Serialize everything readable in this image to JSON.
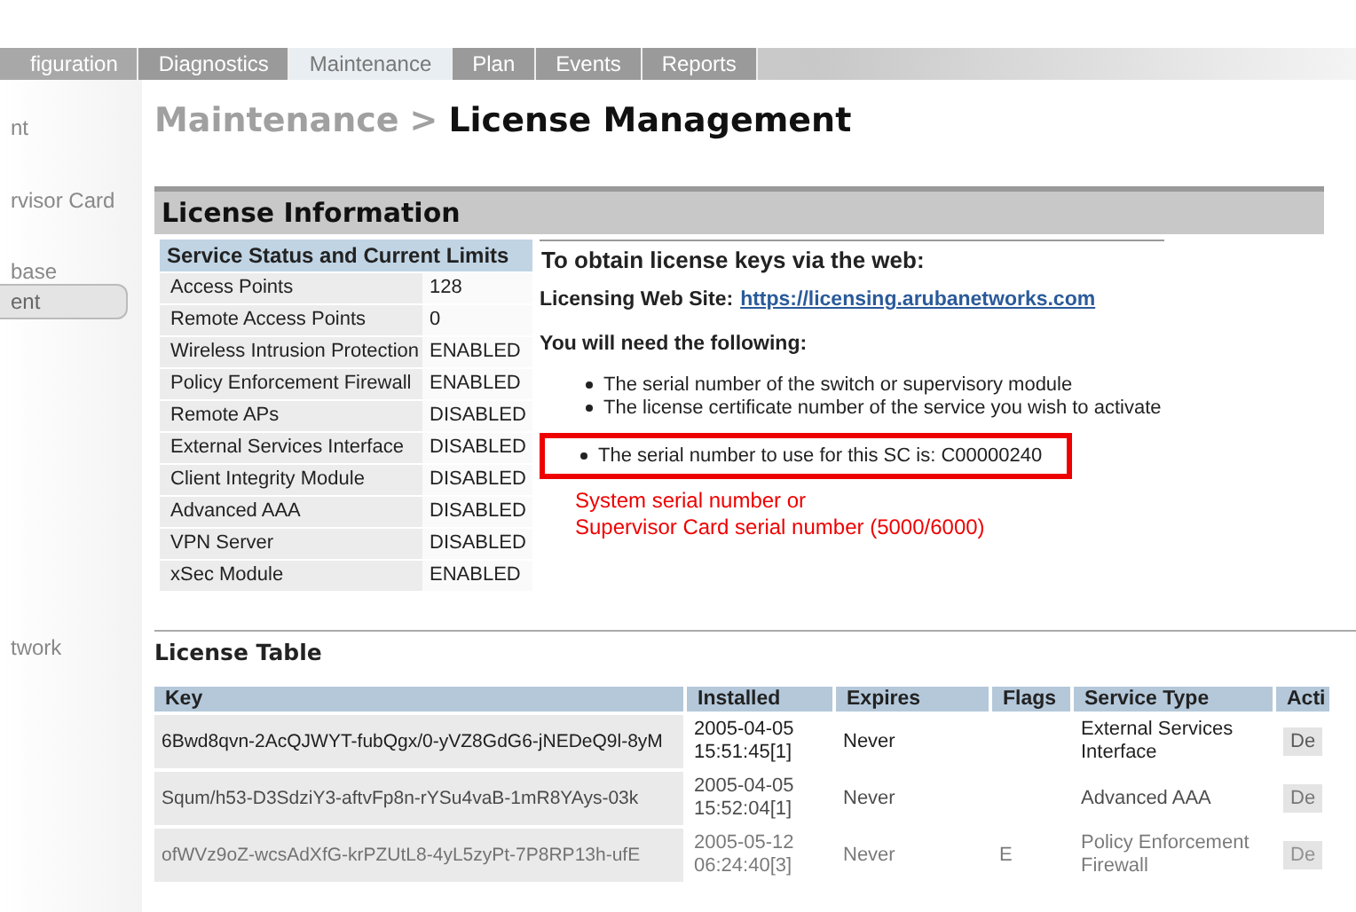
{
  "tabs": [
    {
      "label": "figuration",
      "selected": false
    },
    {
      "label": "Diagnostics",
      "selected": false
    },
    {
      "label": "Maintenance",
      "selected": true
    },
    {
      "label": "Plan",
      "selected": false
    },
    {
      "label": "Events",
      "selected": false
    },
    {
      "label": "Reports",
      "selected": false
    }
  ],
  "sidebar": {
    "items": [
      {
        "label": "nt",
        "selected": false
      },
      {
        "label": "rvisor Card",
        "selected": false
      },
      {
        "label": "base",
        "selected": false
      },
      {
        "label": "ent",
        "selected": true
      },
      {
        "label": "twork",
        "selected": false
      }
    ]
  },
  "breadcrumb": {
    "parent": "Maintenance",
    "separator": ">",
    "current": "License Management"
  },
  "license_information": {
    "title": "License Information",
    "limits": {
      "title": "Service Status and Current Limits",
      "rows": [
        {
          "service": "Access Points",
          "value": "128"
        },
        {
          "service": "Remote Access Points",
          "value": "0"
        },
        {
          "service": "Wireless Intrusion Protection",
          "value": "ENABLED"
        },
        {
          "service": "Policy Enforcement Firewall",
          "value": "ENABLED"
        },
        {
          "service": "Remote APs",
          "value": "DISABLED"
        },
        {
          "service": "External Services Interface",
          "value": "DISABLED"
        },
        {
          "service": "Client Integrity Module",
          "value": "DISABLED"
        },
        {
          "service": "Advanced AAA",
          "value": "DISABLED"
        },
        {
          "service": "VPN Server",
          "value": "DISABLED"
        },
        {
          "service": "xSec Module",
          "value": "ENABLED"
        }
      ]
    },
    "web": {
      "heading": "To obtain license keys via the web:",
      "site_label": "Licensing Web Site:",
      "site_link": "https://licensing.arubanetworks.com",
      "need_heading": "You will need the following:",
      "needs": [
        "The serial number of the switch or supervisory module",
        "The license certificate number of the service you wish to activate"
      ],
      "serial_note": "The serial number to use for this SC is: C00000240",
      "annotation": [
        "System serial number or",
        "Supervisor Card serial number (5000/6000)"
      ]
    }
  },
  "license_table": {
    "title": "License Table",
    "columns": [
      "Key",
      "Installed",
      "Expires",
      "Flags",
      "Service Type",
      "Acti"
    ],
    "rows": [
      {
        "key": "6Bwd8qvn-2AcQJWYT-fubQgx/0-yVZ8GdG6-jNEDeQ9l-8yM",
        "installed": "2005-04-05 15:51:45[1]",
        "expires": "Never",
        "service_type": "External Services Interface",
        "action": "De"
      },
      {
        "key": "Squm/h53-D3SdziY3-aftvFp8n-rYSu4vaB-1mR8YAys-03k",
        "installed": "2005-04-05 15:52:04[1]",
        "expires": "Never",
        "service_type": "Advanced AAA",
        "action": "De"
      },
      {
        "key": "ofWVz9oZ-wcsAdXfG-krPZUtL8-4yL5zyPt-7P8RP13h-ufE",
        "installed": "2005-05-12 06:24:40[3]",
        "expires": "Never",
        "flags": "E",
        "service_type": "Policy Enforcement Firewall",
        "action": "De"
      }
    ]
  }
}
